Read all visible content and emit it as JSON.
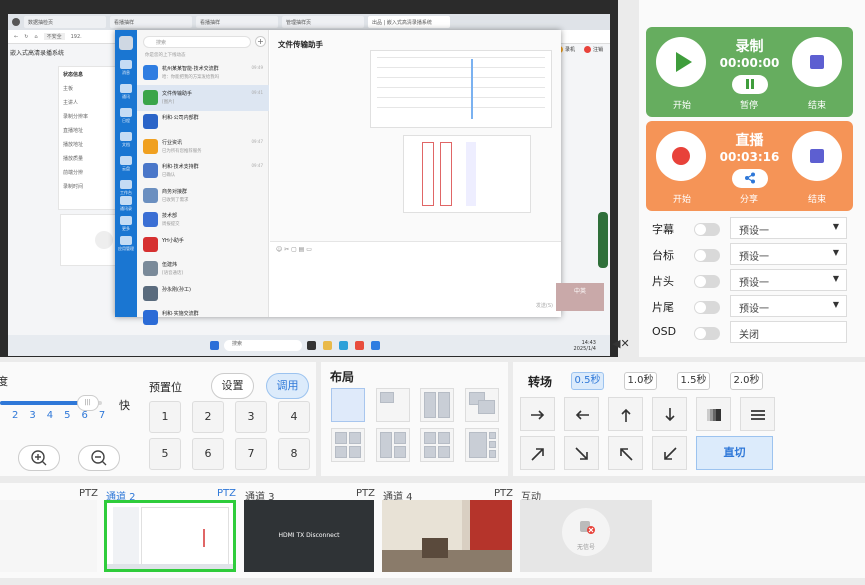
{
  "preview": {
    "tabs": [
      "数据抽检页",
      "看播抽样",
      "看播抽样",
      "管理抽样页",
      "出品 | 嵌入式高清录播系统"
    ],
    "addr_insecure": "不安全",
    "addr_url": "192.",
    "app_title": "嵌入式高清录播系统",
    "top_right": [
      "录机",
      "注销"
    ],
    "stat_title": "状态信息",
    "stat_rows": [
      "主板",
      "主讲人",
      "录制分辨率",
      "直播地址",
      "播放地址",
      "播放质量",
      "前端分辨",
      "录制时间"
    ],
    "messenger": {
      "search_placeholder": "搜索",
      "notice": "你是您的上下线动态",
      "nav": [
        "消息",
        "通讯",
        "日程",
        "文档",
        "云盘",
        "工作台",
        "通讯录",
        "更多",
        "应用管理"
      ],
      "conversations": [
        {
          "name": "杭州某某智能·技术交流群",
          "preview": "哈：你能把我的方案发给我吗",
          "time": "09:49",
          "color": "#2f7de1"
        },
        {
          "name": "文件传输助手",
          "preview": "[图片]",
          "time": "09:41",
          "color": "#3aa54a"
        },
        {
          "name": "利和·公司内部群",
          "preview": "",
          "time": "",
          "color": "#2a64c8"
        },
        {
          "name": "行业资讯",
          "preview": "已为所有您推荐服务",
          "time": "09:47",
          "color": "#f0a020"
        },
        {
          "name": "利和·技术支持群",
          "preview": "已确认",
          "time": "09:47",
          "color": "#4a77c9"
        },
        {
          "name": "商务对接群",
          "preview": "已收到了需求",
          "time": "",
          "color": "#6b8fc0"
        },
        {
          "name": "技术部",
          "preview": "周报提交",
          "time": "",
          "color": "#3b6fd4"
        },
        {
          "name": "YH小助手",
          "preview": "",
          "time": "",
          "color": "#d63030"
        },
        {
          "name": "伍建炜",
          "preview": "[语音通话]",
          "time": "",
          "color": "#7a8a99"
        },
        {
          "name": "孙永刚(孙工)",
          "preview": "",
          "time": "",
          "color": "#5a6b7d"
        },
        {
          "name": "利和·实施交流群",
          "preview": "",
          "time": "",
          "color": "#2b6bd6"
        }
      ],
      "chat_title": "文件传输助手",
      "send_label": "发送(S)"
    },
    "taskbar": {
      "search": "搜索",
      "time": "14:43",
      "date": "2025/1/4"
    },
    "video_badge": "中英"
  },
  "controls": {
    "record": {
      "title": "录制",
      "time": "00:00:00",
      "start": "开始",
      "pause": "暂停",
      "end": "结束"
    },
    "live": {
      "title": "直播",
      "time": "00:03:16",
      "start": "开始",
      "share": "分享",
      "end": "结束"
    },
    "settings": [
      {
        "label": "字幕",
        "value": "预设一",
        "dropdown": true
      },
      {
        "label": "台标",
        "value": "预设一",
        "dropdown": true
      },
      {
        "label": "片头",
        "value": "预设一",
        "dropdown": true
      },
      {
        "label": "片尾",
        "value": "预设一",
        "dropdown": true
      },
      {
        "label": "OSD",
        "value": "关闭",
        "dropdown": false
      }
    ]
  },
  "ptz": {
    "speed_label": "速度",
    "speed_ticks": [
      "2",
      "3",
      "4",
      "5",
      "6",
      "7"
    ],
    "speed_fast": "快",
    "speed_value": 0.86,
    "preset_label": "预置位",
    "set": "设置",
    "recall": "调用",
    "presets": [
      "1",
      "2",
      "3",
      "4",
      "5",
      "6",
      "7",
      "8"
    ]
  },
  "layout": {
    "title": "布局"
  },
  "transition": {
    "title": "转场",
    "speeds": [
      "0.5秒",
      "1.0秒",
      "1.5秒",
      "2.0秒"
    ],
    "active_speed": "0.5秒",
    "direct_cut": "直切"
  },
  "channels": [
    {
      "label": "",
      "ptz": "PTZ"
    },
    {
      "label": "通道 2",
      "ptz": "PTZ",
      "active": true
    },
    {
      "label": "通道 3",
      "ptz": "PTZ",
      "content": "HDMI TX Disconnect"
    },
    {
      "label": "通道 4",
      "ptz": "PTZ"
    },
    {
      "label": "互动",
      "ptz": "",
      "content": "无信号"
    }
  ],
  "colors": {
    "record": "#66ad5f",
    "live": "#f59457",
    "accent": "#2f78d8",
    "active_channel": "#2ecc3b"
  }
}
